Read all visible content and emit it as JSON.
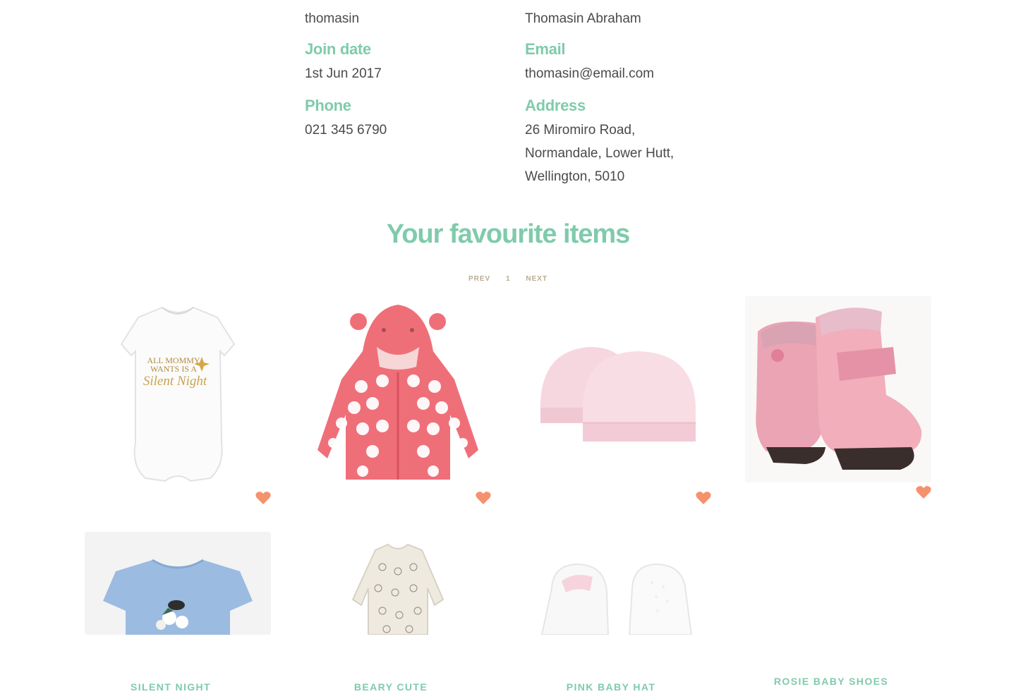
{
  "profile": {
    "username": "thomasin",
    "full_name": "Thomasin Abraham",
    "join_date_label": "Join date",
    "join_date": "1st Jun 2017",
    "email_label": "Email",
    "email": "thomasin@email.com",
    "phone_label": "Phone",
    "phone": "021 345 6790",
    "address_label": "Address",
    "address_line1": "26 Miromiro Road,",
    "address_line2": "Normandale, Lower Hutt,",
    "address_line3": "Wellington, 5010"
  },
  "favourites": {
    "title": "Your favourite items",
    "pager": {
      "prev": "PREV",
      "page": "1",
      "next": "NEXT"
    },
    "items": [
      {
        "name": "SILENT NIGHT",
        "icon": "onesie-image"
      },
      {
        "name": "BEARY CUTE",
        "icon": "cardigan-image"
      },
      {
        "name": "PINK BABY HAT",
        "icon": "hat-image"
      },
      {
        "name": "ROSIE BABY SHOES",
        "icon": "boots-image"
      },
      {
        "name": "",
        "icon": "blue-tshirt-image"
      },
      {
        "name": "",
        "icon": "sleepsuit-image"
      },
      {
        "name": "",
        "icon": "booties-image"
      }
    ],
    "onesie_text": [
      "ALL MOMMY",
      "WANTS IS A",
      "Silent Night"
    ]
  },
  "colors": {
    "accent": "#7fcbab",
    "heart": "#f5926e",
    "pager": "#b9ab93",
    "text": "#4a4a4a"
  }
}
